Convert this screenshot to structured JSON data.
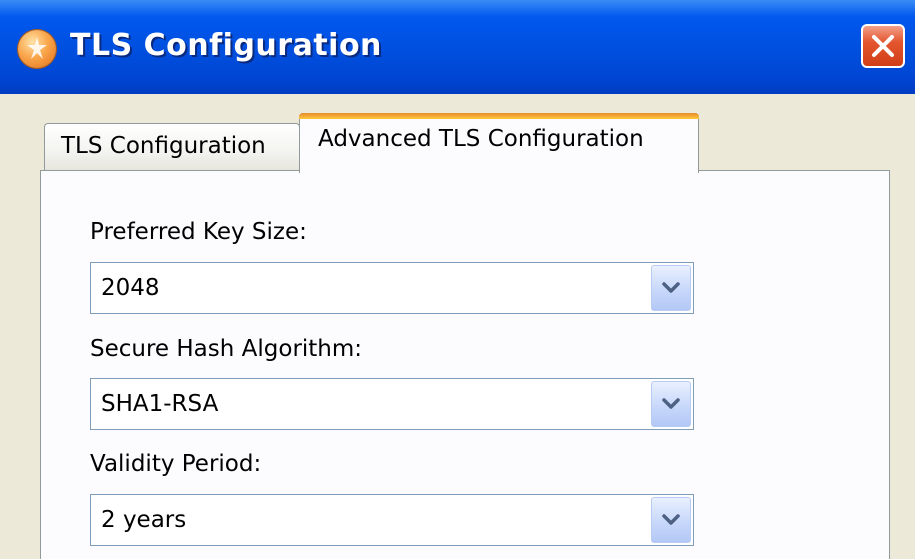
{
  "window": {
    "title": "TLS Configuration"
  },
  "tabs": [
    {
      "label": "TLS Configuration",
      "active": false
    },
    {
      "label": "Advanced TLS Configuration",
      "active": true
    }
  ],
  "fields": {
    "key_size": {
      "label": "Preferred Key Size:",
      "value": "2048"
    },
    "hash_algorithm": {
      "label": "Secure Hash Algorithm:",
      "value": "SHA1-RSA"
    },
    "validity_period": {
      "label": "Validity Period:",
      "value": "2 years"
    }
  },
  "icons": {
    "app": "app-logo-icon",
    "close": "close-icon",
    "dropdown": "chevron-down-icon"
  },
  "colors": {
    "titlebar": "#0050e0",
    "active_tab_highlight": "#ffc73c",
    "close_button": "#d13f17"
  }
}
